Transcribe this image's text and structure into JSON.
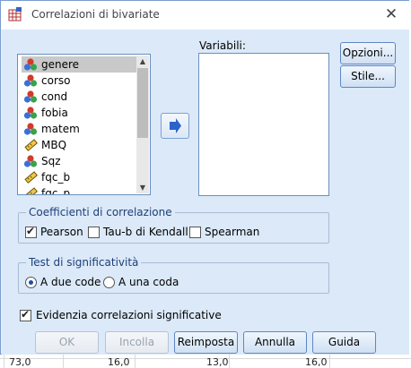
{
  "window": {
    "title": "Correlazioni di bivariate",
    "close_glyph": "✕"
  },
  "variables": {
    "items": [
      {
        "label": "genere",
        "icon": "nominal-icon"
      },
      {
        "label": "corso",
        "icon": "nominal-icon"
      },
      {
        "label": "cond",
        "icon": "nominal-icon"
      },
      {
        "label": "fobia",
        "icon": "nominal-icon"
      },
      {
        "label": "matem",
        "icon": "nominal-icon"
      },
      {
        "label": "MBQ",
        "icon": "scale-icon"
      },
      {
        "label": "Sqz",
        "icon": "nominal-icon"
      },
      {
        "label": "fqc_b",
        "icon": "scale-icon"
      },
      {
        "label": "fqc_p",
        "icon": "scale-icon"
      }
    ],
    "selected_index": 0
  },
  "target": {
    "label": "Variabili:"
  },
  "side_buttons": {
    "options": "Opzioni...",
    "style": "Stile..."
  },
  "correlation": {
    "title": "Coefficienti di correlazione",
    "pearson": "Pearson",
    "kendall": "Tau-b di Kendall",
    "spearman": "Spearman",
    "pearson_checked": true,
    "kendall_checked": false,
    "spearman_checked": false
  },
  "significance": {
    "title": "Test di significatività",
    "two_tailed": "A due code",
    "one_tailed": "A una coda",
    "selected": "two_tailed"
  },
  "flag": {
    "label": "Evidenzia correlazioni significative",
    "checked": true
  },
  "buttons": {
    "ok": "OK",
    "paste": "Incolla",
    "reset": "Reimposta",
    "cancel": "Annulla",
    "help": "Guida"
  },
  "background_row": [
    "73,0",
    "16,0",
    "13,0",
    "16,0"
  ],
  "colors": {
    "accent": "#1c4fae",
    "dialog_bg": "#dbe9f8",
    "border": "#6a8fc0"
  }
}
